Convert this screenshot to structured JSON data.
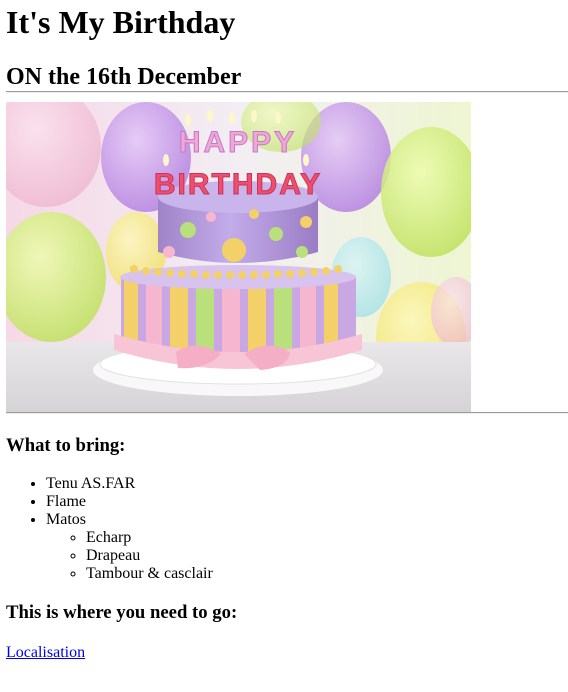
{
  "heading": {
    "title": "It's My Birthday",
    "subtitle": "ON the 16th December"
  },
  "hero_image": {
    "cake_text_line1": "HAPPY",
    "cake_text_line2": "BIRTHDAY",
    "colors": {
      "cake_top": "#b49ad8",
      "cake_bottom_stripes": [
        "#c9a7e3",
        "#f5d46a",
        "#b9e07a",
        "#f6b6d0"
      ],
      "ribbon": "#f7c5d6",
      "plate": "#f2f2f2"
    }
  },
  "bring": {
    "heading": "What to bring:",
    "items": [
      "Tenu AS.FAR",
      "Flame",
      "Matos"
    ],
    "sub_items": [
      "Echarp",
      "Drapeau",
      "Tambour & casclair"
    ]
  },
  "location": {
    "heading": "This is where you need to go:",
    "link_text": "Localisation"
  }
}
